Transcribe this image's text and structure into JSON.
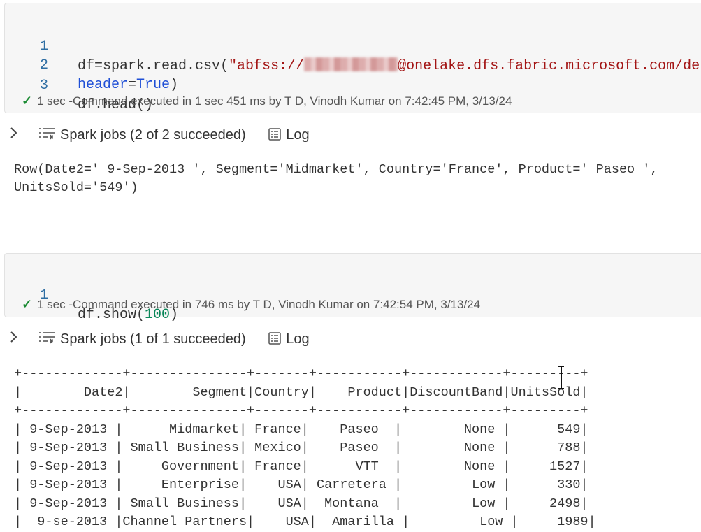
{
  "cell1": {
    "lines": [
      {
        "num": "1",
        "pre": "df=spark.read.csv(",
        "str_pre": "\"abfss://",
        "str_post": "@onelake.dfs.fabric.microsoft.com/de"
      },
      {
        "num": "2",
        "kw": "header",
        "eq": "=",
        "kw2": "True",
        "post": ")"
      },
      {
        "num": "3",
        "text": "df.head()"
      }
    ],
    "status": "1 sec -Command executed in 1 sec 451 ms by T D, Vinodh Kumar on 7:42:45 PM, 3/13/24"
  },
  "jobs1": {
    "label": "Spark jobs (2 of 2 succeeded)",
    "log": "Log"
  },
  "output1": {
    "line1": "Row(Date2=' 9-Sep-2013 ', Segment='Midmarket', Country='France', Product=' Paseo ',",
    "line2": "UnitsSold='549')"
  },
  "cell2": {
    "num": "1",
    "pre": "df.show(",
    "arg": "100",
    "post": ")",
    "status": "1 sec -Command executed in 746 ms by T D, Vinodh Kumar on 7:42:54 PM, 3/13/24"
  },
  "jobs2": {
    "label": "Spark jobs (1 of 1 succeeded)",
    "log": "Log"
  },
  "table": {
    "text": "+-------------+---------------+-------+-----------+------------+---------+\n|        Date2|        Segment|Country|    Product|DiscountBand|UnitsSold|\n+-------------+---------------+-------+-----------+------------+---------+\n| 9-Sep-2013 |      Midmarket| France|    Paseo  |        None |      549|\n| 9-Sep-2013 | Small Business| Mexico|    Paseo  |        None |      788|\n| 9-Sep-2013 |     Government| France|      VTT  |        None |     1527|\n| 9-Sep-2013 |     Enterprise|    USA| Carretera |         Low |      330|\n| 9-Sep-2013 | Small Business|    USA|  Montana  |         Low |     2498|\n|  9-se-2013 |Channel Partners|    USA|  Amarilla |         Low |     1989|"
  }
}
